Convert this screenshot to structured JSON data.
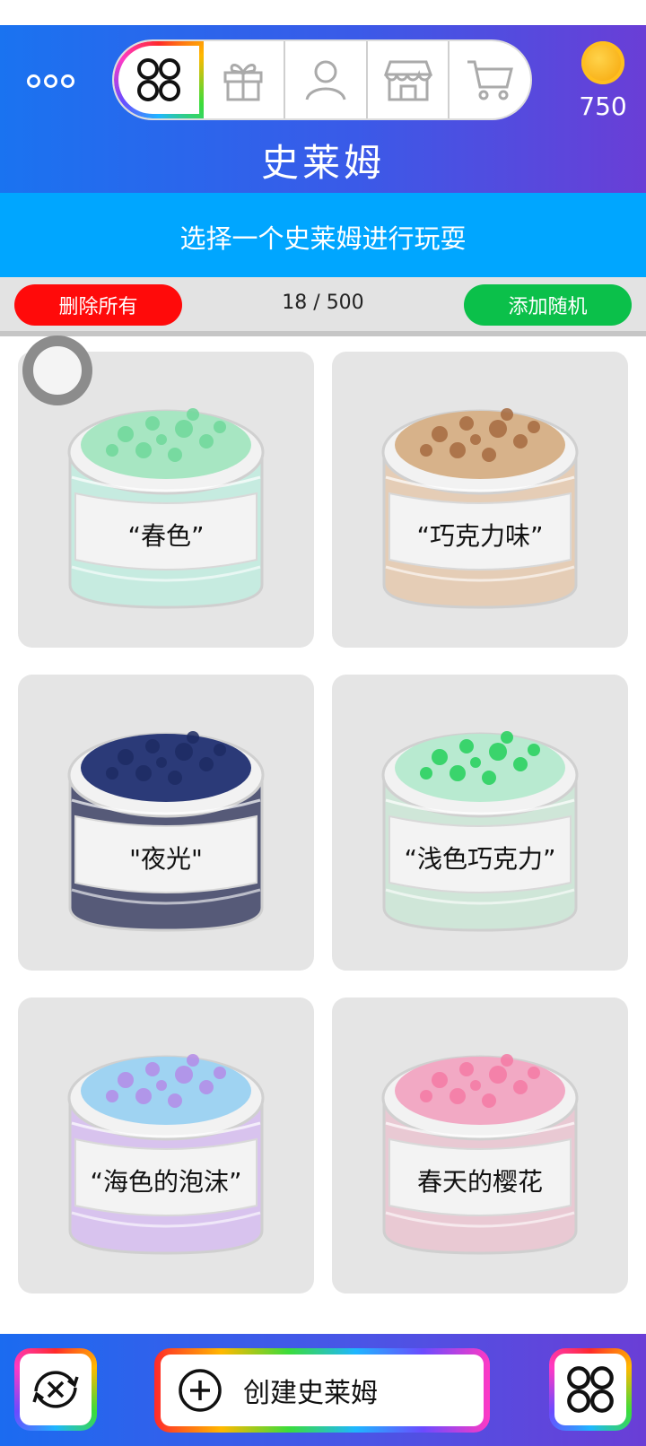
{
  "header": {
    "title": "史莱姆",
    "coins": "750",
    "tabs": [
      {
        "name": "collection",
        "icon": "four-circles-icon",
        "active": true
      },
      {
        "name": "gift",
        "icon": "gift-icon",
        "active": false
      },
      {
        "name": "profile",
        "icon": "user-icon",
        "active": false
      },
      {
        "name": "store",
        "icon": "storefront-icon",
        "active": false
      },
      {
        "name": "cart",
        "icon": "cart-icon",
        "active": false
      }
    ]
  },
  "subtitle": "选择一个史莱姆进行玩耍",
  "controls": {
    "delete_all": "删除所有",
    "count": "18 / 500",
    "add_random": "添加随机"
  },
  "slimes": [
    {
      "label": "“春色”",
      "top": "#a7e6c2",
      "body": "#c6ebe0",
      "accent": "#6fd79a"
    },
    {
      "label": "“巧克力味”",
      "top": "#d7b28a",
      "body": "#e5cdb6",
      "accent": "#a66a40"
    },
    {
      "label": "\"夜光\"",
      "top": "#2b3a78",
      "body": "#565a78",
      "accent": "#1d2b63"
    },
    {
      "label": "“浅色巧克力”",
      "top": "#b8ead0",
      "body": "#cfe6d8",
      "accent": "#23d05a"
    },
    {
      "label": "“海色的泡沫”",
      "top": "#9fd3f2",
      "body": "#d8c3ee",
      "accent": "#b48be8"
    },
    {
      "label": "春天的樱花",
      "top": "#f2a9c4",
      "body": "#e9c9d3",
      "accent": "#f57aa4"
    }
  ],
  "bottom": {
    "create_label": "创建史莱姆",
    "left_icon": "refresh-icon",
    "right_icon": "four-circles-icon"
  }
}
